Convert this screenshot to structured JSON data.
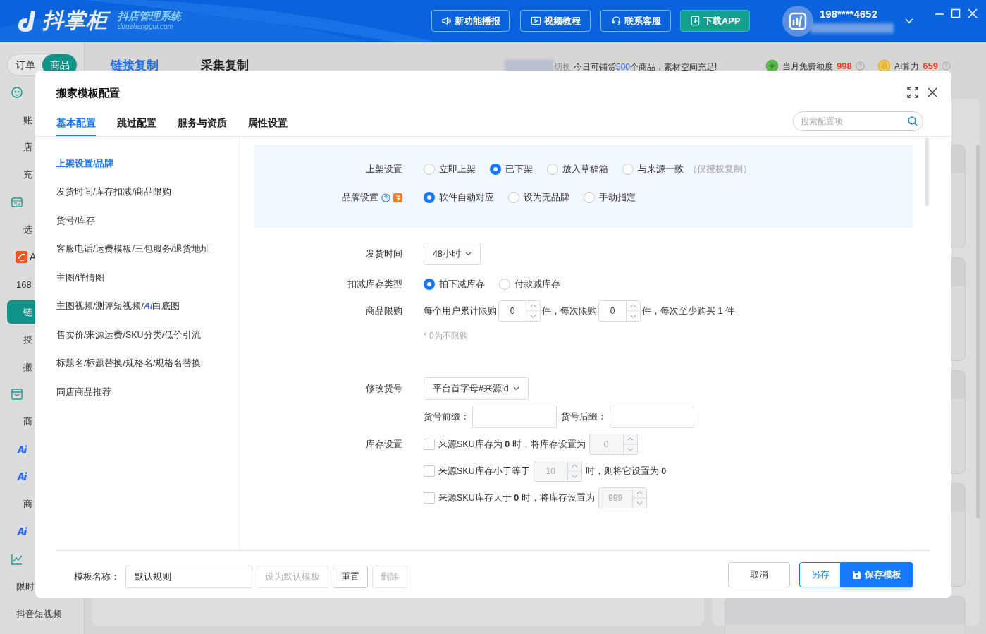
{
  "header": {
    "logo": {
      "name": "抖掌柜",
      "tagline": "抖店管理系统",
      "domain": "douzhanggui.com"
    },
    "buttons": [
      {
        "label": "新功能播报",
        "kind": "outline"
      },
      {
        "label": "视频教程",
        "kind": "outline"
      },
      {
        "label": "联系客服",
        "kind": "outline"
      },
      {
        "label": "下载APP",
        "kind": "teal"
      }
    ],
    "user": {
      "phone": "198****4652"
    }
  },
  "mode_toggle": [
    {
      "label": "订单",
      "selected": false
    },
    {
      "label": "商品",
      "selected": true
    }
  ],
  "sidebar": [
    {
      "kind": "section"
    },
    {
      "kind": "item",
      "text": "账",
      "selected": false
    },
    {
      "kind": "item",
      "text": "店",
      "selected": false
    },
    {
      "kind": "item",
      "text": "充",
      "selected": false
    },
    {
      "kind": "section"
    },
    {
      "kind": "item",
      "text": "选",
      "selected": false
    },
    {
      "kind": "brand",
      "text": "A"
    },
    {
      "kind": "item",
      "text": "168",
      "selected": false
    },
    {
      "kind": "item",
      "text": "链",
      "selected": true
    },
    {
      "kind": "item",
      "text": "授",
      "selected": false
    },
    {
      "kind": "item",
      "text": "搬",
      "selected": false
    },
    {
      "kind": "section"
    },
    {
      "kind": "item",
      "text": "商",
      "selected": false
    },
    {
      "kind": "ai"
    },
    {
      "kind": "ai"
    },
    {
      "kind": "item",
      "text": "商",
      "selected": false
    },
    {
      "kind": "ai"
    },
    {
      "kind": "section"
    },
    {
      "kind": "item",
      "text": "限时",
      "selected": false
    },
    {
      "kind": "item",
      "text": "抖音短视频",
      "selected": false
    }
  ],
  "tabs": [
    {
      "label": "链接复制",
      "selected": true
    },
    {
      "label": "采集复制",
      "selected": false
    }
  ],
  "notice": {
    "switch": "切换",
    "before": "今日可铺货",
    "count": "500",
    "after": "个商品，素材空间充足!"
  },
  "quotas": [
    {
      "label": "当月免费额度",
      "value": "998"
    },
    {
      "label": "AI算力",
      "value": "659"
    }
  ],
  "modal": {
    "title": "搬家模板配置",
    "tabs": [
      {
        "label": "基本配置",
        "selected": true
      },
      {
        "label": "跳过配置",
        "selected": false
      },
      {
        "label": "服务与资质",
        "selected": false
      },
      {
        "label": "属性设置",
        "selected": false
      }
    ],
    "search": {
      "placeholder": "搜索配置项"
    },
    "nav": [
      {
        "label": "上架设置/品牌",
        "selected": true
      },
      {
        "label": "发货时间/库存扣减/商品限购",
        "selected": false
      },
      {
        "label": "货号/库存",
        "selected": false
      },
      {
        "label": "客服电话/运费模板/三包服务/退货地址",
        "selected": false
      },
      {
        "label": "主图/详情图",
        "selected": false
      },
      {
        "label": "主图视频/测评短视频/",
        "ai": "Ai",
        "suffix": "白底图",
        "selected": false
      },
      {
        "label": "售卖价/来源运费/SKU分类/低价引流",
        "selected": false
      },
      {
        "label": "标题名/标题替换/规格名/规格名替换",
        "selected": false
      },
      {
        "label": "同店商品推荐",
        "selected": false
      }
    ],
    "highlight_rows": [
      {
        "kind": "radio",
        "label": "上架设置",
        "options": [
          {
            "label": "立即上架",
            "selected": false
          },
          {
            "label": "已下架",
            "selected": true
          },
          {
            "label": "放入草稿箱",
            "selected": false
          },
          {
            "label": "与来源一致",
            "note": "（仅授权复制）",
            "selected": false
          }
        ]
      },
      {
        "kind": "radio",
        "label": "品牌设置",
        "help": true,
        "badge": true,
        "options": [
          {
            "label": "软件自动对应",
            "selected": true
          },
          {
            "label": "设为无品牌",
            "selected": false
          },
          {
            "label": "手动指定",
            "selected": false
          }
        ]
      }
    ],
    "rows": [
      {
        "kind": "select",
        "label": "发货时间",
        "value": "48小时"
      },
      {
        "kind": "radio",
        "label": "扣减库存类型",
        "options": [
          {
            "label": "拍下减库存",
            "selected": true
          },
          {
            "label": "付款减库存",
            "selected": false
          }
        ]
      },
      {
        "kind": "inline",
        "label": "商品限购",
        "parts": [
          {
            "kind": "text",
            "text": "每个用户累计限购"
          },
          {
            "kind": "stepper",
            "value": "0"
          },
          {
            "kind": "text",
            "text": "件，每次限购"
          },
          {
            "kind": "stepper",
            "value": "0"
          },
          {
            "kind": "text",
            "text": "件，每次至少购买 1 件"
          }
        ],
        "hint": "* 0为不限购"
      },
      {
        "kind": "select",
        "label": "修改货号",
        "value": "平台首字母#来源id"
      },
      {
        "kind": "affix",
        "fields": [
          {
            "label": "货号前缀："
          },
          {
            "label": "货号后缀："
          }
        ]
      },
      {
        "kind": "checks",
        "label": "库存设置",
        "items": [
          {
            "checked": false,
            "before": "来源SKU库存为 **0** 时，将库存设置为",
            "value": "0"
          },
          {
            "checked": false,
            "before": "来源SKU库存小于等于",
            "value": "10",
            "after": "时，则将它设置为 **0**"
          },
          {
            "checked": false,
            "before": "来源SKU库存大于 **0** 时，将库存设置为",
            "value": "999"
          }
        ]
      }
    ],
    "footer": {
      "name_label": "模板名称：",
      "name_value": "默认规则",
      "buttons": [
        {
          "label": "设为默认模板",
          "disabled": true
        },
        {
          "label": "重置",
          "disabled": false
        },
        {
          "label": "删除",
          "disabled": true
        }
      ],
      "actions": [
        {
          "label": "取消",
          "kind": "default"
        },
        {
          "label": "另存",
          "kind": "outline"
        },
        {
          "label": "保存模板",
          "kind": "primary"
        }
      ]
    }
  }
}
